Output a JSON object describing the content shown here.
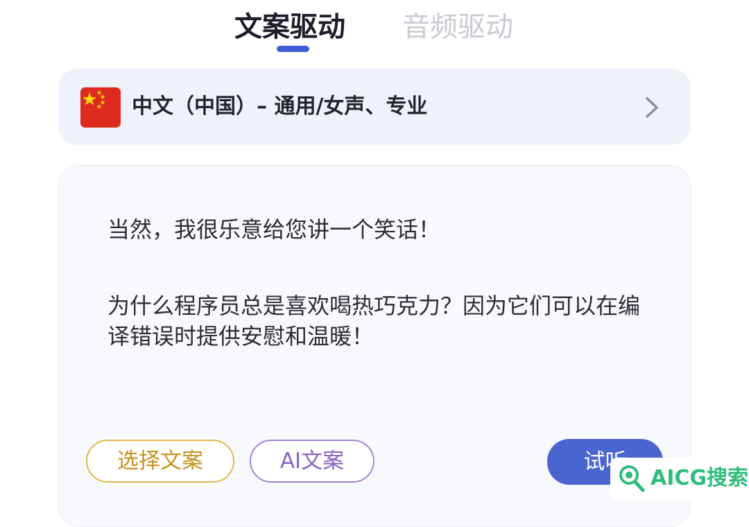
{
  "tabs": [
    {
      "label": "文案驱动",
      "active": true
    },
    {
      "label": "音频驱动",
      "active": false
    }
  ],
  "language": {
    "flag_icon": "china-flag-icon",
    "label": "中文（中国）– 通用/女声、专业",
    "chevron_icon": "chevron-right-icon"
  },
  "script_text": {
    "line1": "当然，我很乐意给您讲一个笑话！",
    "line2": "为什么程序员总是喜欢喝热巧克力？因为它们可以在编译错误时提供安慰和温暖！"
  },
  "buttons": {
    "select_script": "选择文案",
    "ai_script": "AI文案",
    "listen": "试听"
  },
  "watermark": {
    "icon": "magnifier-icon",
    "text": "AICG搜索"
  },
  "colors": {
    "accent_blue": "#4a64d0",
    "select_border": "#e2b64a",
    "ai_border": "#a485d2",
    "watermark_green": "#2ebd7a"
  }
}
